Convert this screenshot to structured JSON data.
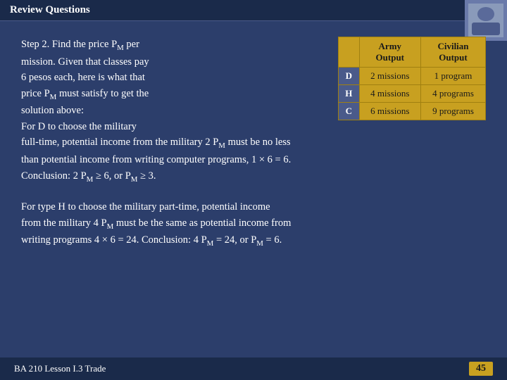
{
  "header": {
    "title": "Review Questions"
  },
  "corner_image_label": "photo",
  "step2_text": {
    "line1": "Step 2. Find the price P",
    "line1_sub": "M",
    "line1_rest": " per",
    "line2": "mission.  Given that classes pay",
    "line3": "6 pesos each, here is what that",
    "line4": "price P",
    "line4_sub": "M",
    "line4_rest": " must satisfy to get the",
    "line5": "solution above:",
    "line6": "For D to choose the military",
    "line7_start": "full-time, potential income from the military 2 P",
    "line7_sub": "M",
    "line7_rest": " must be no less",
    "line8": "than potential income from writing computer programs, 1 × 6 = 6.",
    "line9": "Conclusion: 2 P",
    "line9_sub1": "M",
    "line9_mid": " ≥ 6, or P",
    "line9_sub2": "M",
    "line9_end": " ≥ 3."
  },
  "lower_text": {
    "line1_start": "For type H to choose the military part-time, potential income",
    "line2_start": "from the military 4 P",
    "line2_sub": "M",
    "line2_rest": " must be the same as potential income from",
    "line3": "writing programs 4 × 6 = 24.  Conclusion: 4 P",
    "line3_sub": "M",
    "line3_rest": " = 24, or P",
    "line3_sub2": "M",
    "line3_end": " = 6."
  },
  "table": {
    "col1_header": "",
    "col2_header_line1": "Army",
    "col2_header_line2": "Output",
    "col3_header_line1": "Civilian",
    "col3_header_line2": "Output",
    "rows": [
      {
        "label": "D",
        "army": "2 missions",
        "civilian": "1 program"
      },
      {
        "label": "H",
        "army": "4 missions",
        "civilian": "4 programs"
      },
      {
        "label": "C",
        "army": "6 missions",
        "civilian": "9 programs"
      }
    ]
  },
  "footer": {
    "course": "BA 210  Lesson I.3 Trade",
    "page": "45"
  }
}
